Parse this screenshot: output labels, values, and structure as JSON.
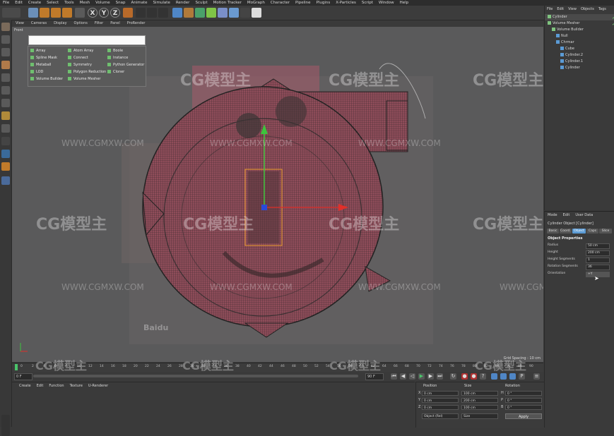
{
  "menubar": [
    "File",
    "Edit",
    "Create",
    "Select",
    "Tools",
    "Mesh",
    "Volume",
    "Snap",
    "Animate",
    "Simulate",
    "Render",
    "Sculpt",
    "Motion Tracker",
    "MoGraph",
    "Character",
    "Pipeline",
    "Plugins",
    "X-Particles",
    "Script",
    "Window",
    "Help"
  ],
  "viewport": {
    "menu": [
      "View",
      "Cameras",
      "Display",
      "Options",
      "Filter",
      "Panel",
      "ProRender"
    ],
    "label": "Front",
    "grid_spacing": "Grid Spacing : 10 cm",
    "generator_menu": [
      [
        "Array",
        "Atom Array",
        "Boole"
      ],
      [
        "Spline Mask",
        "Connect",
        "Instance"
      ],
      [
        "Metaball",
        "Symmetry",
        "Python Generator"
      ],
      [
        "LOD",
        "Polygon Reduction",
        "Cloner"
      ],
      [
        "Volume Builder",
        "Volume Mesher",
        ""
      ]
    ],
    "watermark_logo": "CG模型主",
    "watermark_url": "WWW.CGMXW.COM",
    "baidu_mark": "Baidu"
  },
  "timeline": {
    "ticks": [
      "0",
      "2",
      "4",
      "6",
      "8",
      "10",
      "12",
      "14",
      "16",
      "18",
      "20",
      "22",
      "24",
      "26",
      "28",
      "30",
      "32",
      "34",
      "36",
      "38",
      "40",
      "42",
      "44",
      "46",
      "48",
      "50",
      "52",
      "54",
      "56",
      "58",
      "60",
      "62",
      "64",
      "66",
      "68",
      "70",
      "72",
      "74",
      "76",
      "78",
      "80",
      "82",
      "84",
      "86",
      "88",
      "90"
    ],
    "end_frame": "0 F",
    "start_field": "0 F",
    "current_field": "0 F",
    "max_field": "90 F"
  },
  "material_panel": {
    "menu": [
      "Create",
      "Edit",
      "Function",
      "Texture",
      "U-Renderer"
    ]
  },
  "coords": {
    "headers": [
      "Position",
      "Size",
      "Rotation"
    ],
    "rows": [
      {
        "axis": "X",
        "pos": "0 cm",
        "size": "100 cm",
        "rot_axis": "H",
        "rot": "0 °"
      },
      {
        "axis": "Y",
        "pos": "0 cm",
        "size": "200 cm",
        "rot_axis": "P",
        "rot": "0 °"
      },
      {
        "axis": "Z",
        "pos": "0 cm",
        "size": "100 cm",
        "rot_axis": "B",
        "rot": "0 °"
      }
    ],
    "mode_dropdown": "Object (Rel)",
    "size_dropdown": "Size",
    "apply_label": "Apply"
  },
  "objects_panel": {
    "menu": [
      "File",
      "Edit",
      "View",
      "Objects",
      "Tags"
    ],
    "items": [
      {
        "name": "Cylinder",
        "indent": 0,
        "icon": "g"
      },
      {
        "name": "Volume Mesher",
        "indent": 0,
        "icon": "g"
      },
      {
        "name": "Volume Builder",
        "indent": 1,
        "icon": "g"
      },
      {
        "name": "Null",
        "indent": 2,
        "icon": "b"
      },
      {
        "name": "Chrmar",
        "indent": 2,
        "icon": "b"
      },
      {
        "name": "Cube",
        "indent": 3,
        "icon": "b"
      },
      {
        "name": "Cylinder.2",
        "indent": 3,
        "icon": "b"
      },
      {
        "name": "Cylinder.1",
        "indent": 3,
        "icon": "b"
      },
      {
        "name": "Cylinder",
        "indent": 3,
        "icon": "b"
      }
    ]
  },
  "attributes_panel": {
    "menu": [
      "Mode",
      "Edit",
      "User Data"
    ],
    "title": "Cylinder Object [Cylinder]",
    "tabs": [
      "Basic",
      "Coord.",
      "Object",
      "Caps",
      "Slice"
    ],
    "active_tab": "Object",
    "section": "Object Properties",
    "props": [
      {
        "label": "Radius",
        "value": "50 cm"
      },
      {
        "label": "Height",
        "value": "200 cm"
      },
      {
        "label": "Height Segments",
        "value": "1"
      },
      {
        "label": "Rotation Segments",
        "value": "36"
      },
      {
        "label": "Orientation",
        "value": "+Y"
      }
    ]
  },
  "colors": {
    "accent": "#5b9bd5",
    "mesh": "#b35a6b",
    "bg": "#3a3a3a"
  }
}
